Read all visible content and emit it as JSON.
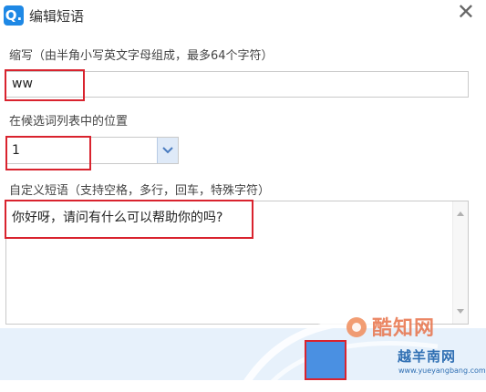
{
  "window": {
    "app_icon_letter": "Q.",
    "title": "编辑短语",
    "close_glyph": "✕"
  },
  "abbreviation": {
    "label": "缩写（由半角小写英文字母组成，最多64个字符）",
    "value": "ww"
  },
  "position": {
    "label": "在候选词列表中的位置",
    "selected": "1"
  },
  "phrase": {
    "label": "自定义短语（支持空格，多行，回车，特殊字符）",
    "value": "你好呀，请问有什么可以帮助你的吗?"
  },
  "watermark": {
    "brand_cn": "酷知网",
    "site_cn": "越羊南网",
    "site_url": "www.yueyangbang.com"
  },
  "colors": {
    "accent": "#1e88e5",
    "highlight": "#d9232e",
    "footer": "#e7f1fb"
  }
}
